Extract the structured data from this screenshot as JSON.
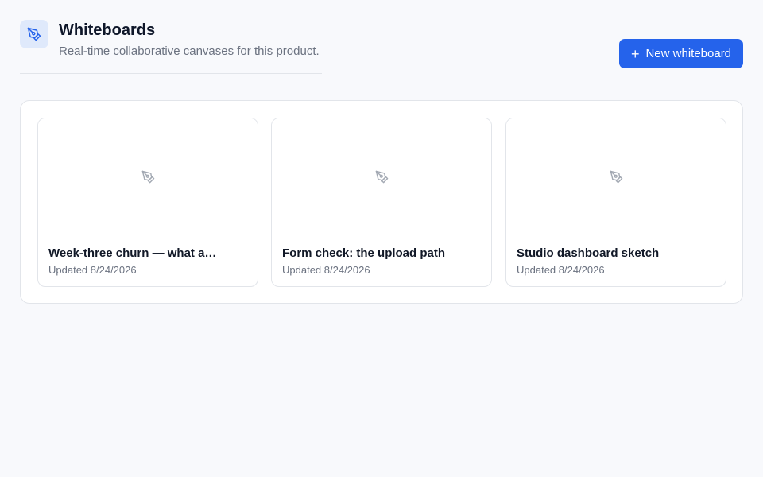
{
  "header": {
    "title": "Whiteboards",
    "subtitle": "Real-time collaborative canvases for this product.",
    "icon": "pen-tool-icon"
  },
  "actions": {
    "new_label": "New whiteboard",
    "new_icon": "plus-icon"
  },
  "whiteboards": [
    {
      "title": "Week-three churn — what a…",
      "updated": "Updated 8/24/2026",
      "icon": "pen-tool-icon"
    },
    {
      "title": "Form check: the upload path",
      "updated": "Updated 8/24/2026",
      "icon": "pen-tool-icon"
    },
    {
      "title": "Studio dashboard sketch",
      "updated": "Updated 8/24/2026",
      "icon": "pen-tool-icon"
    }
  ],
  "colors": {
    "accent": "#2563eb",
    "icon_bg": "#dfe9fb",
    "page_bg": "#f8f9fc"
  }
}
